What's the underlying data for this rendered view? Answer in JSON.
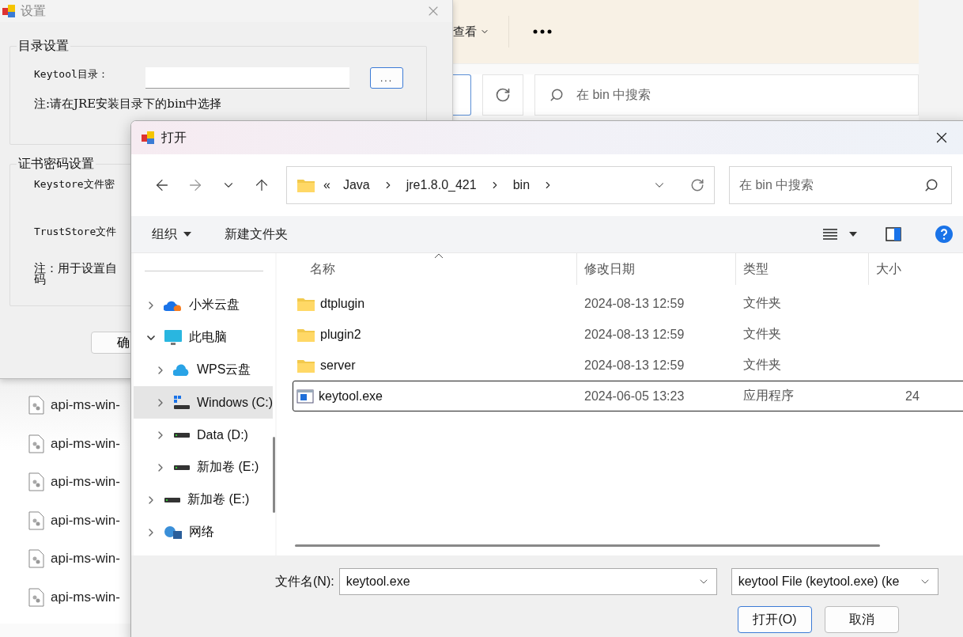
{
  "background_explorer": {
    "view_menu": "查看",
    "search": {
      "placeholder": "在 bin 中搜索"
    },
    "files": [
      {
        "name": "api-ms-win-"
      },
      {
        "name": "api-ms-win-"
      },
      {
        "name": "api-ms-win-"
      },
      {
        "name": "api-ms-win-"
      },
      {
        "name": "api-ms-win-"
      },
      {
        "name": "api-ms-win-"
      }
    ]
  },
  "settings_window": {
    "title": "设置",
    "directory_group": {
      "title": "目录设置",
      "keytool_label": "Keytool目录：",
      "browse_button": "...",
      "note": "注:请在JRE安装目录下的bin中选择"
    },
    "password_group": {
      "title": "证书密码设置",
      "keystore_label": "Keystore文件密",
      "truststore_label": "TrustStore文件",
      "note_lines": [
        "注：用于设置自",
        "码"
      ]
    },
    "confirm_button": "确"
  },
  "open_dialog": {
    "title": "打开",
    "address": {
      "prefix": "«",
      "segments": [
        "Java",
        "jre1.8.0_421",
        "bin"
      ]
    },
    "search": {
      "placeholder": "在 bin 中搜索"
    },
    "toolbar": {
      "organize": "组织",
      "new_folder": "新建文件夹"
    },
    "nav_tree": [
      {
        "label": "小米云盘",
        "kind": "cloud-orange",
        "expanded": false,
        "selected": false
      },
      {
        "label": "此电脑",
        "kind": "pc",
        "expanded": true,
        "selected": false,
        "children": [
          {
            "label": "WPS云盘",
            "kind": "cloud-blue",
            "expanded": false,
            "selected": false
          },
          {
            "label": "Windows (C:)",
            "kind": "system-drive",
            "expanded": false,
            "selected": true
          },
          {
            "label": "Data (D:)",
            "kind": "drive",
            "expanded": false,
            "selected": false
          },
          {
            "label": "新加卷 (E:)",
            "kind": "drive",
            "expanded": false,
            "selected": false
          }
        ]
      },
      {
        "label": "新加卷 (E:)",
        "kind": "drive",
        "expanded": false,
        "selected": false
      },
      {
        "label": "网络",
        "kind": "network",
        "expanded": false,
        "selected": false
      }
    ],
    "columns": [
      "名称",
      "修改日期",
      "类型",
      "大小"
    ],
    "files": [
      {
        "name": "dtplugin",
        "modified": "2024-08-13 12:59",
        "type": "文件夹",
        "kind": "folder",
        "selected": false
      },
      {
        "name": "plugin2",
        "modified": "2024-08-13 12:59",
        "type": "文件夹",
        "kind": "folder",
        "selected": false
      },
      {
        "name": "server",
        "modified": "2024-08-13 12:59",
        "type": "文件夹",
        "kind": "folder",
        "selected": false
      },
      {
        "name": "keytool.exe",
        "modified": "2024-06-05 13:23",
        "type": "应用程序",
        "size": "24",
        "kind": "app",
        "selected": true
      }
    ],
    "filename_label": "文件名(N):",
    "filename": "keytool.exe",
    "filter": "keytool File (keytool.exe) (ke",
    "open_button": "打开(O)",
    "cancel_button": "取消"
  }
}
